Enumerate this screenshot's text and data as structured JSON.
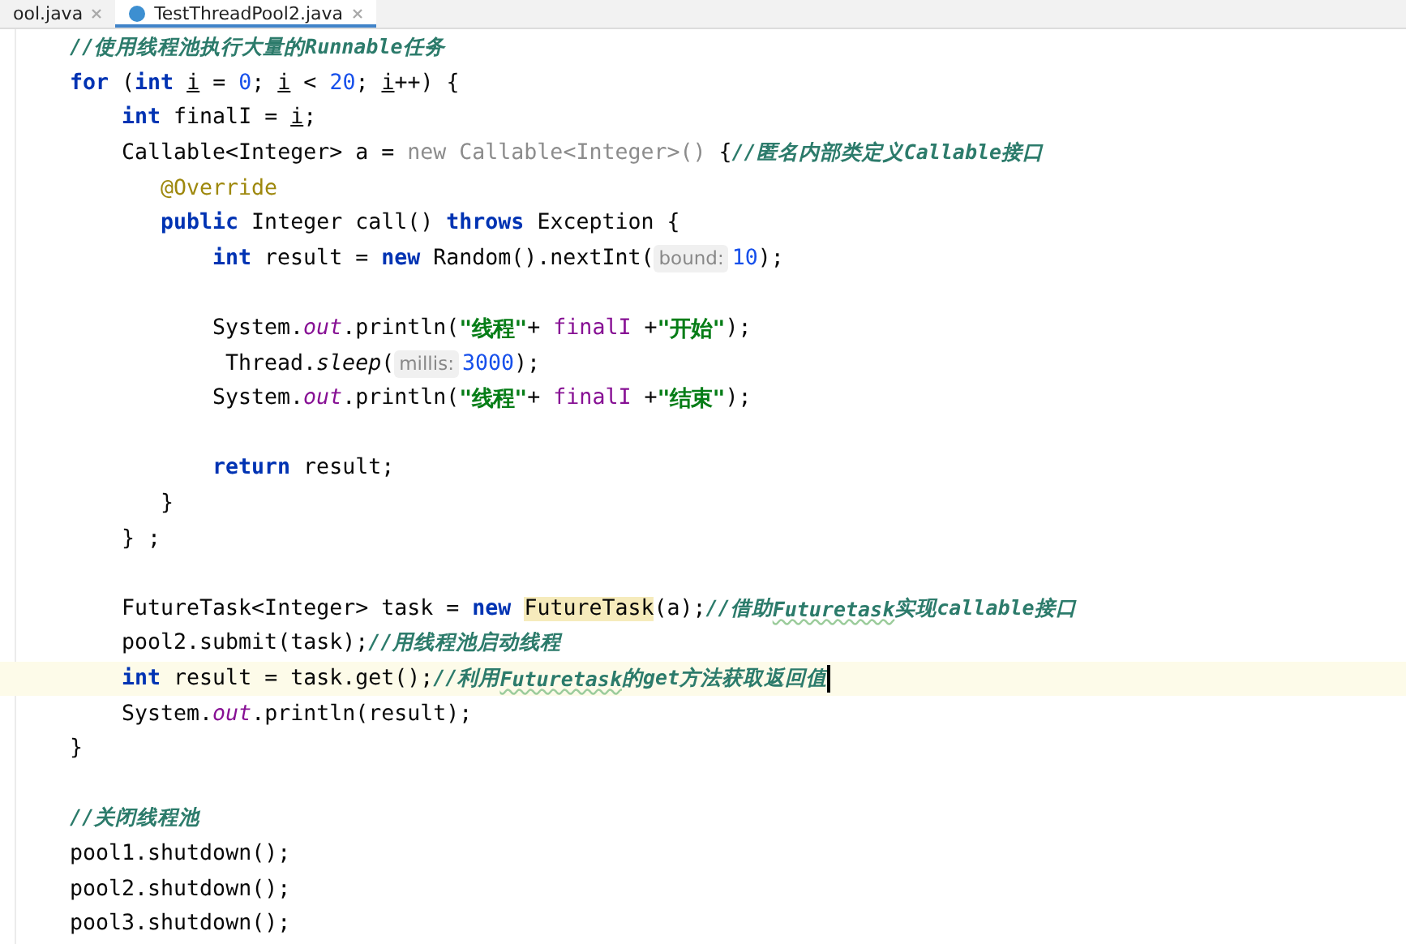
{
  "tabs": [
    {
      "label": "ool.java",
      "selected": false
    },
    {
      "label": "TestThreadPool2.java",
      "selected": true
    }
  ],
  "code_lines": [
    {
      "kind": "statement",
      "current": false,
      "tokens": [
        {
          "kind": "comment",
          "text": "//使用线程池执行大量的Runnable任务"
        }
      ]
    },
    {
      "kind": "statement",
      "current": false,
      "tokens": [
        {
          "kind": "keyword",
          "text": "for"
        },
        {
          "kind": "plain",
          "text": " ("
        },
        {
          "kind": "keyword",
          "text": "int "
        },
        {
          "kind": "variable",
          "text": "i"
        },
        {
          "kind": "plain",
          "text": " = "
        },
        {
          "kind": "number",
          "text": "0"
        },
        {
          "kind": "plain",
          "text": "; "
        },
        {
          "kind": "variable",
          "text": "i"
        },
        {
          "kind": "plain",
          "text": " < "
        },
        {
          "kind": "number",
          "text": "20"
        },
        {
          "kind": "plain",
          "text": "; "
        },
        {
          "kind": "variable",
          "text": "i"
        },
        {
          "kind": "plain",
          "text": "++) {"
        }
      ],
      "children": [
        {
          "kind": "statement",
          "current": false,
          "tokens": [
            {
              "kind": "keyword",
              "text": "int"
            },
            {
              "kind": "plain",
              "text": " finalI = "
            },
            {
              "kind": "variable",
              "text": "i"
            },
            {
              "kind": "plain",
              "text": ";"
            }
          ]
        },
        {
          "kind": "anon-class",
          "current": false,
          "tokens": [
            {
              "kind": "plain",
              "text": "Callable<Integer> a = "
            },
            {
              "kind": "dim",
              "text": "new Callable<Integer>()"
            },
            {
              "kind": "plain",
              "text": " {"
            },
            {
              "kind": "comment",
              "text": "//匿名内部类定义Callable接口"
            }
          ],
          "children": [
            {
              "kind": "statement",
              "current": false,
              "tokens": [
                {
                  "kind": "annotation",
                  "text": "@Override"
                }
              ]
            },
            {
              "kind": "statement",
              "current": false,
              "tokens": [
                {
                  "kind": "keyword",
                  "text": "public"
                },
                {
                  "kind": "plain",
                  "text": " Integer call() "
                },
                {
                  "kind": "keyword",
                  "text": "throws"
                },
                {
                  "kind": "plain",
                  "text": " Exception {"
                }
              ],
              "children": [
                {
                  "kind": "statement",
                  "current": false,
                  "tokens": [
                    {
                      "kind": "keyword",
                      "text": "int"
                    },
                    {
                      "kind": "plain",
                      "text": " result = "
                    },
                    {
                      "kind": "keyword",
                      "text": "new"
                    },
                    {
                      "kind": "plain",
                      "text": " Random().nextInt("
                    },
                    {
                      "kind": "hint",
                      "text": "bound:"
                    },
                    {
                      "kind": "number",
                      "text": "10"
                    },
                    {
                      "kind": "plain",
                      "text": ");"
                    }
                  ]
                },
                {
                  "kind": "blank"
                },
                {
                  "kind": "statement",
                  "current": false,
                  "tokens": [
                    {
                      "kind": "plain",
                      "text": "System."
                    },
                    {
                      "kind": "field",
                      "text": "out"
                    },
                    {
                      "kind": "plain",
                      "text": ".println("
                    },
                    {
                      "kind": "string",
                      "text": "\"线程\""
                    },
                    {
                      "kind": "plain",
                      "text": "+ "
                    },
                    {
                      "kind": "captured",
                      "text": "finalI"
                    },
                    {
                      "kind": "plain",
                      "text": " +"
                    },
                    {
                      "kind": "string",
                      "text": "\"开始\""
                    },
                    {
                      "kind": "plain",
                      "text": ");"
                    }
                  ]
                },
                {
                  "kind": "statement",
                  "current": false,
                  "tokens": [
                    {
                      "kind": "plain",
                      "text": " Thread."
                    },
                    {
                      "kind": "static",
                      "text": "sleep"
                    },
                    {
                      "kind": "plain",
                      "text": "("
                    },
                    {
                      "kind": "hint",
                      "text": "millis:"
                    },
                    {
                      "kind": "number",
                      "text": "3000"
                    },
                    {
                      "kind": "plain",
                      "text": ");"
                    }
                  ]
                },
                {
                  "kind": "statement",
                  "current": false,
                  "tokens": [
                    {
                      "kind": "plain",
                      "text": "System."
                    },
                    {
                      "kind": "field",
                      "text": "out"
                    },
                    {
                      "kind": "plain",
                      "text": ".println("
                    },
                    {
                      "kind": "string",
                      "text": "\"线程\""
                    },
                    {
                      "kind": "plain",
                      "text": "+ "
                    },
                    {
                      "kind": "captured",
                      "text": "finalI"
                    },
                    {
                      "kind": "plain",
                      "text": " +"
                    },
                    {
                      "kind": "string",
                      "text": "\"结束\""
                    },
                    {
                      "kind": "plain",
                      "text": ");"
                    }
                  ]
                },
                {
                  "kind": "blank"
                },
                {
                  "kind": "statement",
                  "current": false,
                  "tokens": [
                    {
                      "kind": "keyword",
                      "text": "return"
                    },
                    {
                      "kind": "plain",
                      "text": " result;"
                    }
                  ]
                }
              ]
            },
            {
              "kind": "statement",
              "current": false,
              "tokens": [
                {
                  "kind": "plain",
                  "text": "}"
                }
              ]
            }
          ]
        },
        {
          "kind": "statement",
          "current": false,
          "tokens": [
            {
              "kind": "plain",
              "text": "} ;"
            }
          ]
        },
        {
          "kind": "blank"
        },
        {
          "kind": "statement",
          "current": false,
          "tokens": [
            {
              "kind": "plain",
              "text": "FutureTask<Integer> task = "
            },
            {
              "kind": "keyword",
              "text": "new "
            },
            {
              "kind": "highlight",
              "text": "FutureTask"
            },
            {
              "kind": "plain",
              "text": "(a);"
            },
            {
              "kind": "comment",
              "text": "//借助"
            },
            {
              "kind": "typo",
              "text": "Futuretask"
            },
            {
              "kind": "comment",
              "text": "实现callable接口"
            }
          ]
        },
        {
          "kind": "statement",
          "current": false,
          "tokens": [
            {
              "kind": "plain",
              "text": "pool2.submit(task);"
            },
            {
              "kind": "comment",
              "text": "//用线程池启动线程"
            }
          ]
        },
        {
          "kind": "statement",
          "current": true,
          "tokens": [
            {
              "kind": "keyword",
              "text": "int"
            },
            {
              "kind": "plain",
              "text": " result = task.get();"
            },
            {
              "kind": "comment",
              "text": "//利用"
            },
            {
              "kind": "typo",
              "text": "Futuretask"
            },
            {
              "kind": "comment",
              "text": "的get方法获取返回值"
            }
          ]
        },
        {
          "kind": "statement",
          "current": false,
          "tokens": [
            {
              "kind": "plain",
              "text": "System."
            },
            {
              "kind": "field",
              "text": "out"
            },
            {
              "kind": "plain",
              "text": ".println(result);"
            }
          ]
        }
      ]
    },
    {
      "kind": "statement",
      "current": false,
      "tokens": [
        {
          "kind": "plain",
          "text": "}"
        }
      ]
    },
    {
      "kind": "blank"
    },
    {
      "kind": "statement",
      "current": false,
      "tokens": [
        {
          "kind": "comment",
          "text": "//关闭线程池"
        }
      ]
    },
    {
      "kind": "statement",
      "current": false,
      "tokens": [
        {
          "kind": "plain",
          "text": "pool1.shutdown();"
        }
      ]
    },
    {
      "kind": "statement",
      "current": false,
      "tokens": [
        {
          "kind": "plain",
          "text": "pool2.shutdown();"
        }
      ]
    },
    {
      "kind": "statement",
      "current": false,
      "tokens": [
        {
          "kind": "plain",
          "text": "pool3.shutdown();"
        }
      ]
    }
  ]
}
